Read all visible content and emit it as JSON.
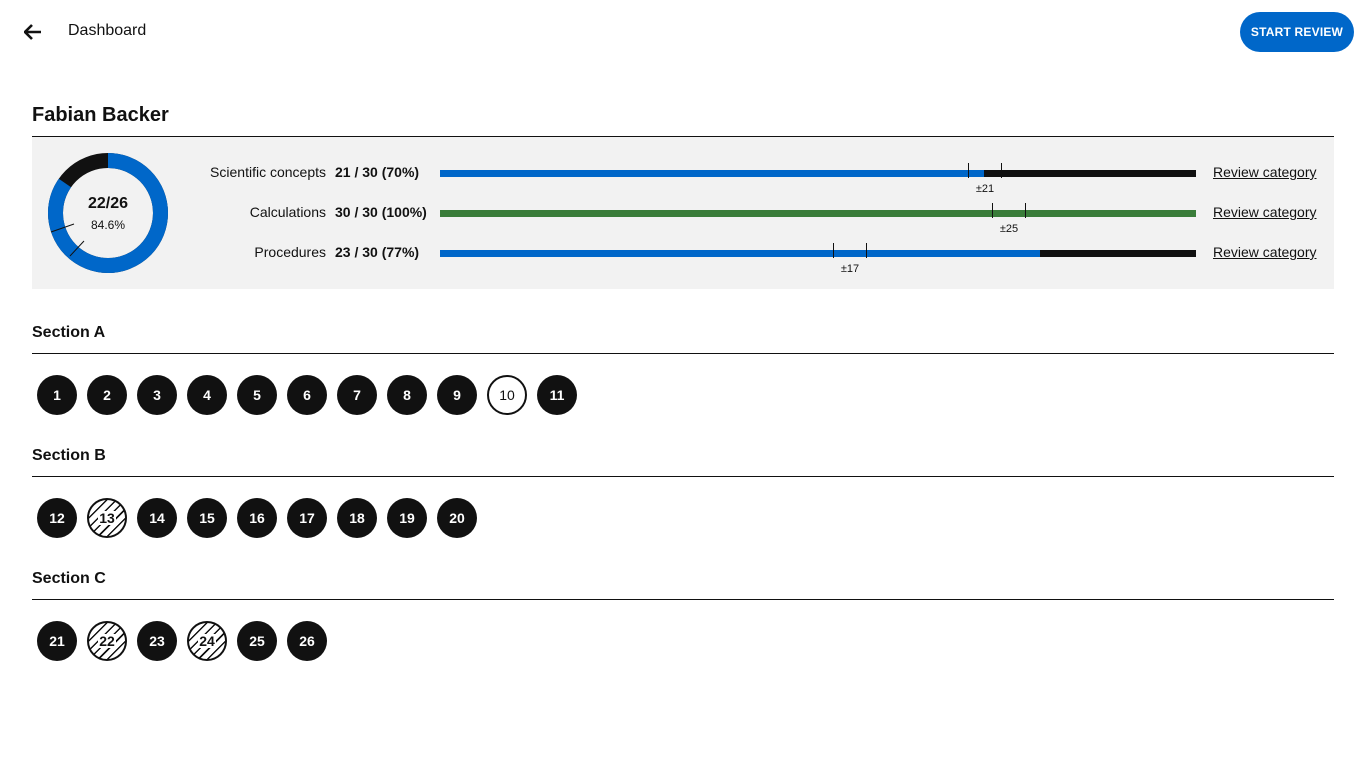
{
  "header": {
    "title": "Dashboard",
    "start_label": "START REVIEW"
  },
  "student": {
    "name": "Fabian Backer"
  },
  "summary": {
    "score_fraction": "22/26",
    "score_percent": "84.6%",
    "score_value": 0.846,
    "colors": {
      "correct": "#0067c9",
      "incorrect": "#111111",
      "perfect": "#3a7d3a"
    }
  },
  "categories": [
    {
      "label": "Scientific concepts",
      "score": "21 / 30 (70%)",
      "fill": 0.72,
      "color": "#0067c9",
      "error_label": "±21",
      "review_label": "Review category"
    },
    {
      "label": "Calculations",
      "score": "30 / 30 (100%)",
      "fill": 1.0,
      "color": "#3a7d3a",
      "error_label": "±25",
      "review_label": "Review category"
    },
    {
      "label": "Procedures",
      "score": "23 / 30 (77%)",
      "fill": 0.793,
      "color": "#0067c9",
      "error_label": "±17",
      "review_label": "Review category"
    }
  ],
  "sections": [
    {
      "title": "Section A",
      "questions": [
        {
          "num": "1",
          "state": "done"
        },
        {
          "num": "2",
          "state": "done"
        },
        {
          "num": "3",
          "state": "done"
        },
        {
          "num": "4",
          "state": "done"
        },
        {
          "num": "5",
          "state": "done"
        },
        {
          "num": "6",
          "state": "done"
        },
        {
          "num": "7",
          "state": "done"
        },
        {
          "num": "8",
          "state": "done"
        },
        {
          "num": "9",
          "state": "done"
        },
        {
          "num": "10",
          "state": "empty"
        },
        {
          "num": "11",
          "state": "done"
        }
      ]
    },
    {
      "title": "Section B",
      "questions": [
        {
          "num": "12",
          "state": "done"
        },
        {
          "num": "13",
          "state": "partial"
        },
        {
          "num": "14",
          "state": "done"
        },
        {
          "num": "15",
          "state": "done"
        },
        {
          "num": "16",
          "state": "done"
        },
        {
          "num": "17",
          "state": "done"
        },
        {
          "num": "18",
          "state": "done"
        },
        {
          "num": "19",
          "state": "done"
        },
        {
          "num": "20",
          "state": "done"
        }
      ]
    },
    {
      "title": "Section C",
      "questions": [
        {
          "num": "21",
          "state": "done"
        },
        {
          "num": "22",
          "state": "partial"
        },
        {
          "num": "23",
          "state": "done"
        },
        {
          "num": "24",
          "state": "partial"
        },
        {
          "num": "25",
          "state": "done"
        },
        {
          "num": "26",
          "state": "done"
        }
      ]
    }
  ]
}
